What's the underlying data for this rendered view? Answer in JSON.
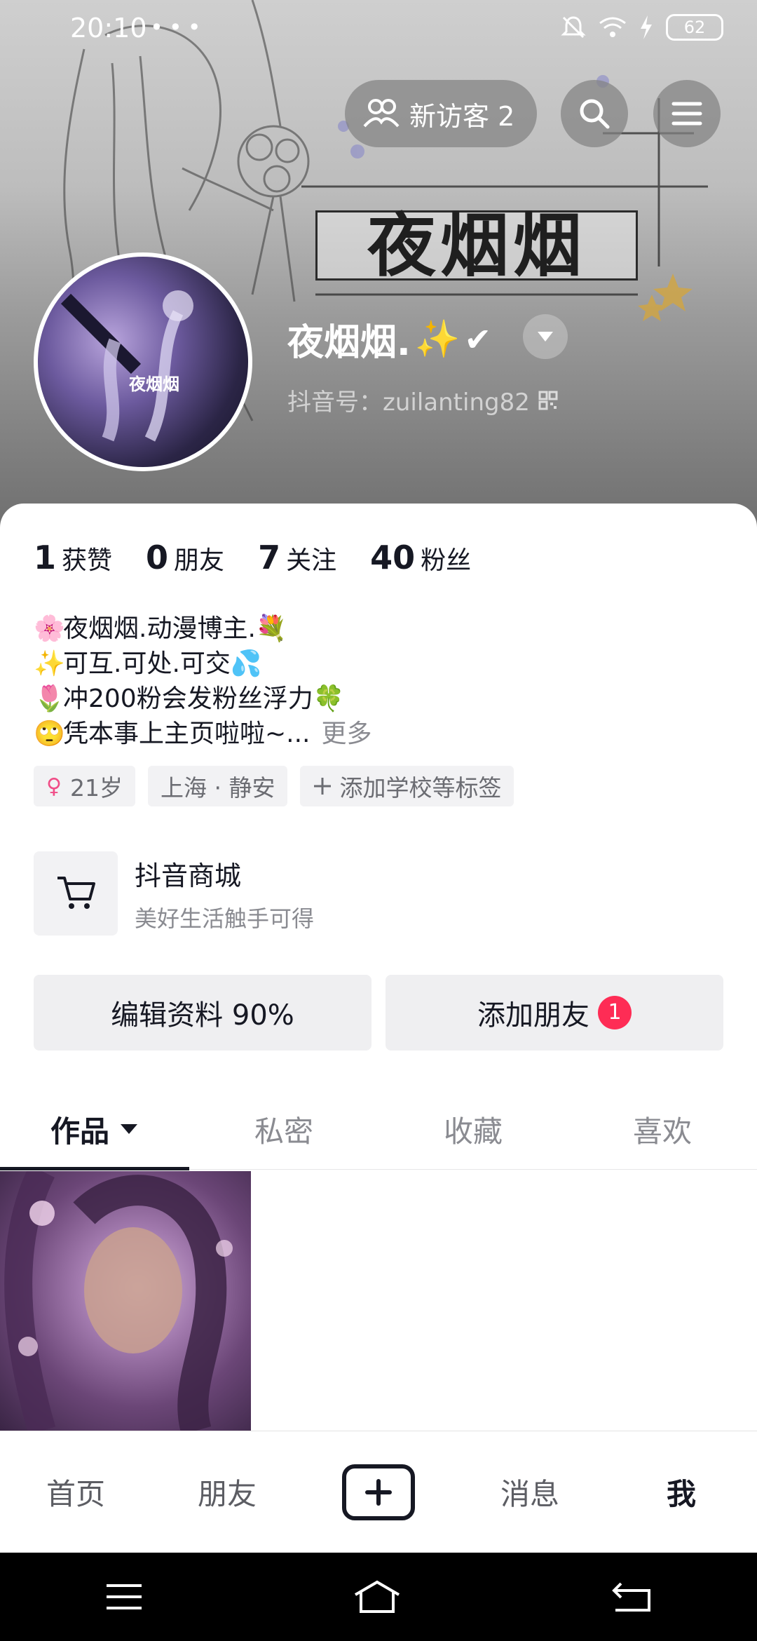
{
  "status_bar": {
    "time": "20:10",
    "left_icons": "",
    "after_time_icons": "•••",
    "battery": "62"
  },
  "header": {
    "visitor_label": "新访客 2",
    "banner_title": "夜烟烟",
    "avatar_text": "夜烟烟"
  },
  "profile": {
    "name": "夜烟烟.",
    "name_sparkle": "✨",
    "name_check": "✔",
    "douyin_id": "抖音号：zuilanting82"
  },
  "stats": [
    {
      "num": "1",
      "label": "获赞"
    },
    {
      "num": "0",
      "label": "朋友"
    },
    {
      "num": "7",
      "label": "关注"
    },
    {
      "num": "40",
      "label": "粉丝"
    }
  ],
  "bio": {
    "line1": {
      "emoji_left": "🌸",
      "text": "夜烟烟.动漫博主.",
      "emoji_right": "💐"
    },
    "line2": {
      "emoji_left": "✨",
      "text": "可互.可处.可交",
      "emoji_right": "💦"
    },
    "line3": {
      "emoji_left": "🌷",
      "text": "冲200粉会发粉丝浮力",
      "emoji_right": "🍀"
    },
    "line4": {
      "emoji_left": "🙄",
      "text": "凭本事上主页啦啦~...",
      "more": "更多"
    }
  },
  "tags": {
    "age_symbol": "♀",
    "age": "21岁",
    "location": "上海 · 静安",
    "add_label": "添加学校等标签"
  },
  "mall": {
    "title": "抖音商城",
    "subtitle": "美好生活触手可得"
  },
  "actions": {
    "edit_label": "编辑资料 90%",
    "add_friend_label": "添加朋友",
    "add_friend_badge": "1"
  },
  "tabs": [
    {
      "label": "作品"
    },
    {
      "label": "私密"
    },
    {
      "label": "收藏"
    },
    {
      "label": "喜欢"
    }
  ],
  "bottom_nav": {
    "home": "首页",
    "friends": "朋友",
    "messages": "消息",
    "me": "我"
  },
  "colors": {
    "accent_red": "#fe2c55",
    "text_primary": "#161823",
    "text_secondary": "#8a8b91"
  }
}
